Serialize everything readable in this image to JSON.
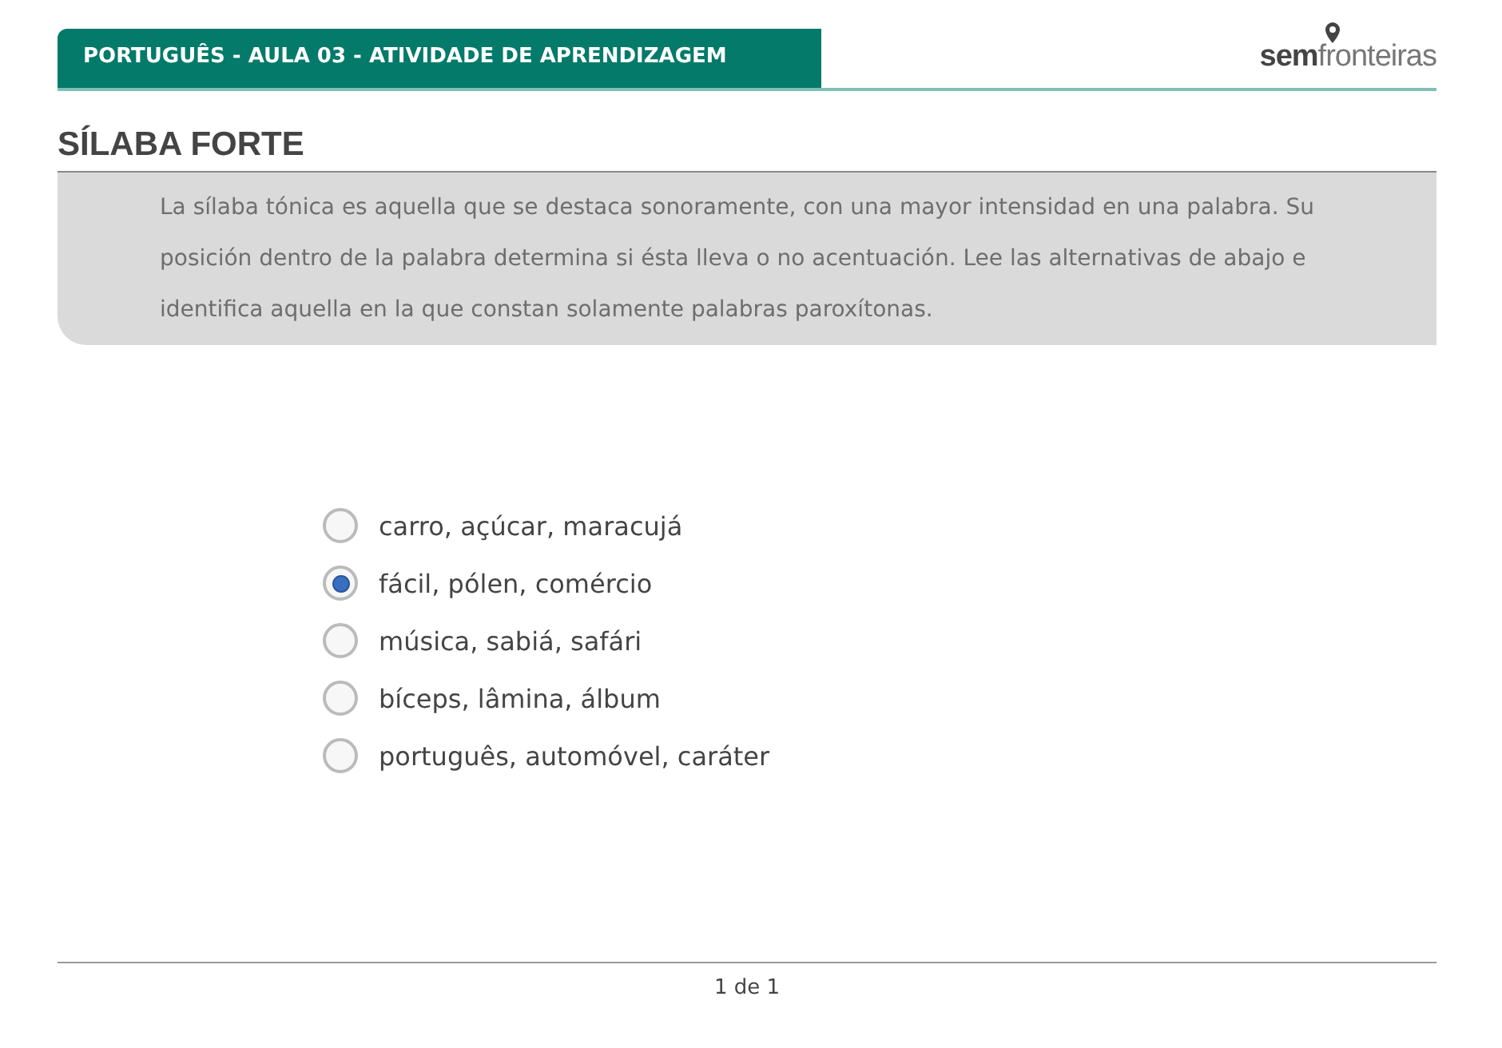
{
  "header": {
    "title": "PORTUGUÊS - AULA 03 - ATIVIDADE DE APRENDIZAGEM",
    "logo": "**sem**fronteiras"
  },
  "section_title": "SÍLABA FORTE",
  "instructions": "La sílaba tónica es aquella que se destaca sonoramente, con una mayor intensidad en una palabra. Su posición dentro de la palabra determina si ésta lleva o no acentuación. Lee las alternativas de abajo e identifica aquella en la que constan solamente palabras paroxítonas.",
  "options": [
    {
      "label": "carro, açúcar, maracujá",
      "selected": false
    },
    {
      "label": "fácil, pólen, comércio",
      "selected": true
    },
    {
      "label": "música, sabiá, safári",
      "selected": false
    },
    {
      "label": "bíceps, lâmina, álbum",
      "selected": false
    },
    {
      "label": "português, automóvel, caráter",
      "selected": false
    }
  ],
  "pager": "1 de 1"
}
